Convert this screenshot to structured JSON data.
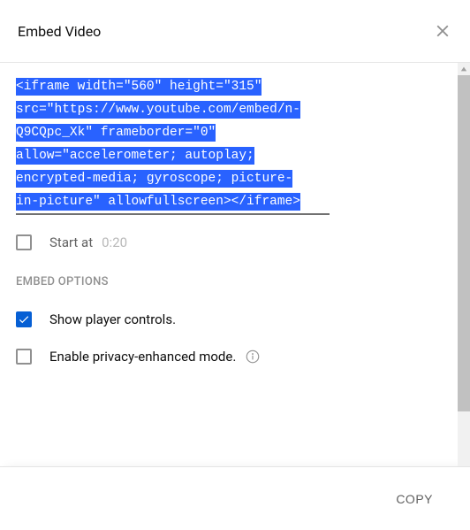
{
  "header": {
    "title": "Embed Video"
  },
  "code": {
    "text": "<iframe width=\"560\" height=\"315\" src=\"https://www.youtube.com/embed/n-Q9CQpc_Xk\" frameborder=\"0\" allow=\"accelerometer; autoplay; encrypted-media; gyroscope; picture-in-picture\" allowfullscreen></iframe>"
  },
  "startAt": {
    "label": "Start at",
    "time": "0:20"
  },
  "optionsTitle": "EMBED OPTIONS",
  "options": {
    "playerControls": "Show player controls.",
    "privacy": "Enable privacy-enhanced mode."
  },
  "footer": {
    "copy": "COPY"
  }
}
